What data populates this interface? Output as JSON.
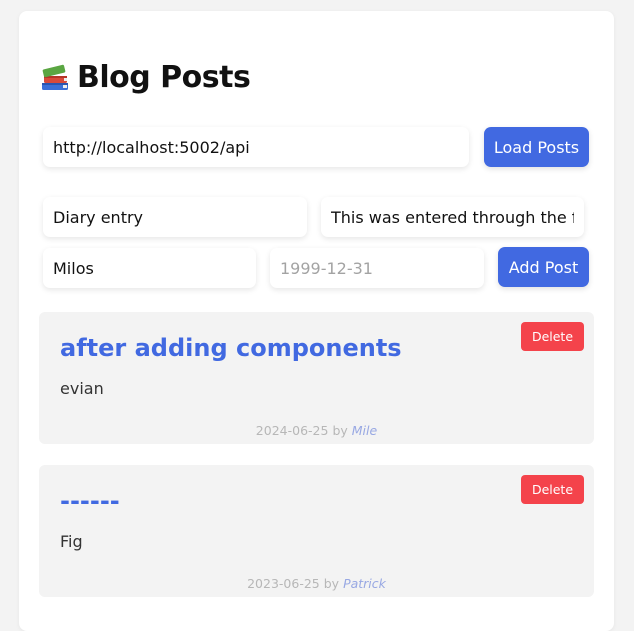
{
  "header": {
    "icon": "books-icon",
    "title": "Blog Posts"
  },
  "api": {
    "url_value": "http://localhost:5002/api",
    "load_label": "Load Posts"
  },
  "form": {
    "title_value": "Diary entry",
    "body_value": "This was entered through the f",
    "author_value": "Milos",
    "date_placeholder": "1999-12-31",
    "add_label": "Add Post"
  },
  "posts": [
    {
      "title": "after adding components",
      "body": "evian",
      "date": "2024-06-25",
      "by": "by",
      "author": "Mile",
      "delete_label": "Delete"
    },
    {
      "title": "------",
      "body": "Fig",
      "date": "2023-06-25",
      "by": "by",
      "author": "Patrick",
      "delete_label": "Delete"
    }
  ],
  "colors": {
    "accent": "#4169e1",
    "danger": "#f4434b",
    "card_bg": "#f3f3f3"
  }
}
